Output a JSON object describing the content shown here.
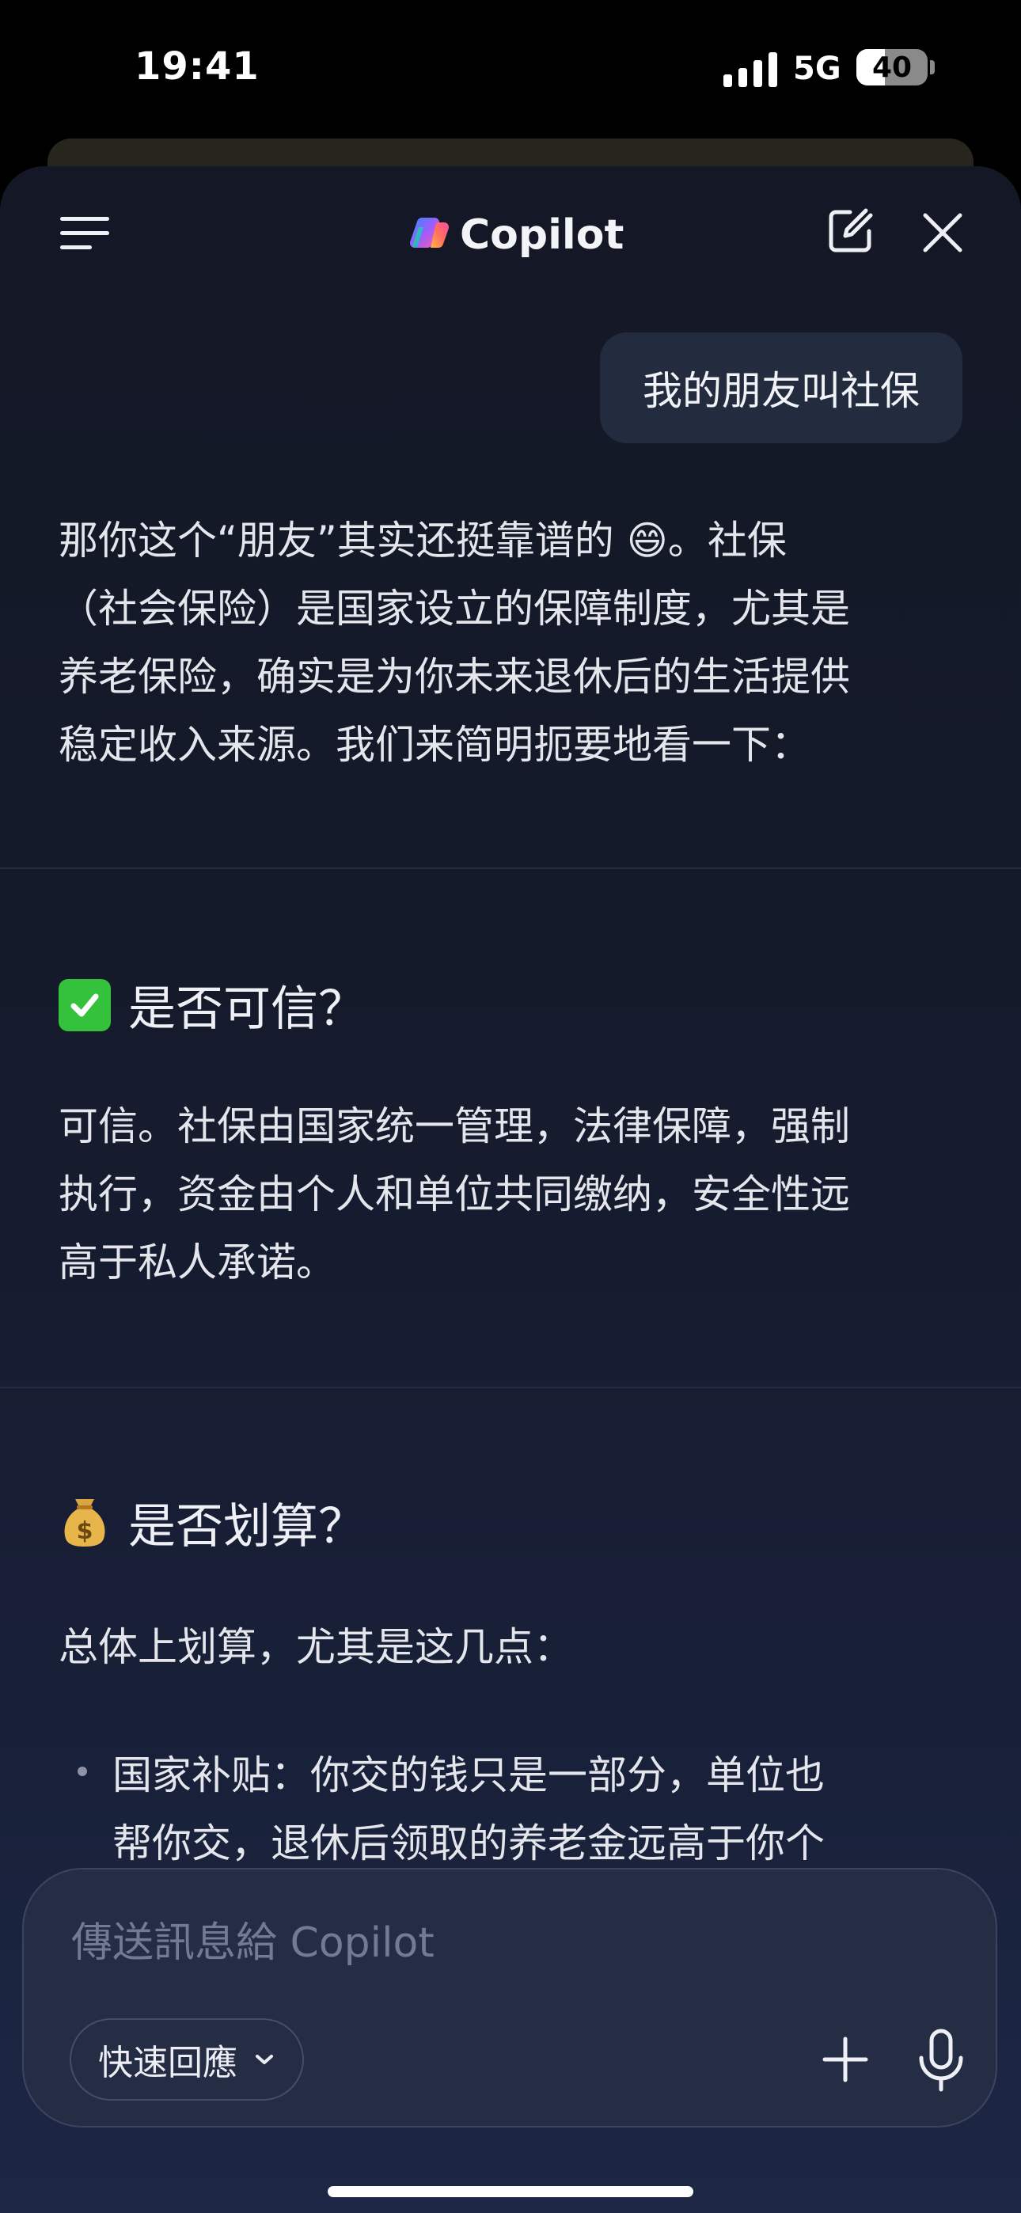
{
  "status_bar": {
    "time": "19:41",
    "network": "5G",
    "battery": "40",
    "battery_level": 0.4
  },
  "header": {
    "app_name": "Copilot",
    "menu_icon": "hamburger-menu-icon",
    "new_chat_icon": "compose-icon",
    "close_icon": "close-icon"
  },
  "conversation": {
    "user_message": "我的朋友叫社保",
    "reply": {
      "intro_lines": [
        "那你这个“朋友”其实还挺靠谱的 😄。社保",
        "（社会保险）是国家设立的保障制度，尤其是",
        "养老保险，确实是为你未来退休后的生活提供",
        "稳定收入来源。我们来简明扼要地看一下："
      ],
      "section1": {
        "heading": "是否可信？",
        "icon": "check-mark-icon",
        "lines": [
          "可信。社保由国家统一管理，法律保障，强制",
          "执行，资金由个人和单位共同缴纳，安全性远",
          "高于私人承诺。"
        ]
      },
      "section2": {
        "heading": "是否划算？",
        "icon": "money-bag-icon",
        "intro": "总体上划算，尤其是这几点：",
        "bullet_lines": [
          "国家补贴：你交的钱只是一部分，单位也",
          "帮你交，退休后领取的养老金远高于你个"
        ]
      }
    }
  },
  "composer": {
    "placeholder": "傳送訊息給 Copilot",
    "quick_reply_label": "快速回應",
    "plus_icon": "plus-icon",
    "mic_icon": "microphone-icon"
  },
  "colors": {
    "background_top": "#141826",
    "background_bottom": "#1d2745",
    "user_bubble": "#232c3f",
    "composer": "#252d44",
    "check_green": "#34c23d"
  }
}
